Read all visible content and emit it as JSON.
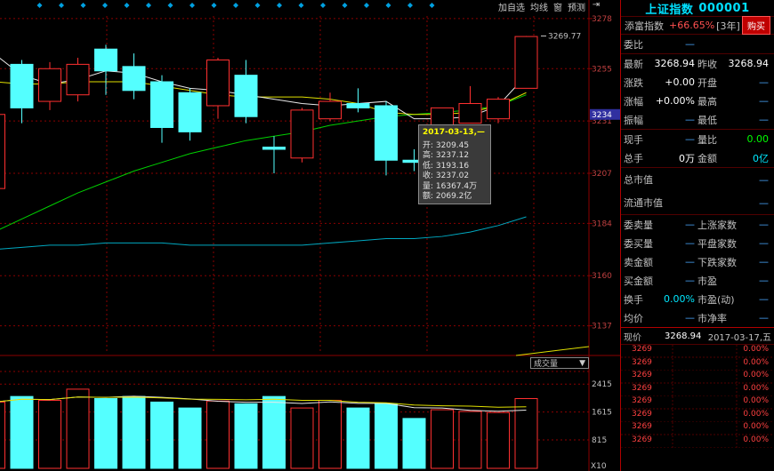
{
  "toolbar": {
    "add_watchlist": "加自选",
    "ma_lines": "均线",
    "window": "窗",
    "forecast": "预测",
    "collapse_icon": "panel-collapse-icon"
  },
  "chart_data": {
    "type": "candlestick",
    "price_axis": {
      "ticks": [
        "3278",
        "3255",
        "3231",
        "3207",
        "3184",
        "3160",
        "3137"
      ],
      "current_label": "3234",
      "ylim": [
        3125,
        3280
      ]
    },
    "volume_axis": {
      "ticks": [
        "2415",
        "1615",
        "815"
      ],
      "unit": "X10"
    },
    "candles": [
      {
        "open": 3200,
        "close": 3234,
        "high": 3238,
        "low": 3193
      },
      {
        "open": 3257,
        "close": 3237,
        "high": 3259,
        "low": 3230
      },
      {
        "open": 3240,
        "close": 3255,
        "high": 3258,
        "low": 3236
      },
      {
        "open": 3243,
        "close": 3257,
        "high": 3260,
        "low": 3240
      },
      {
        "open": 3264,
        "close": 3254,
        "high": 3266,
        "low": 3243
      },
      {
        "open": 3256,
        "close": 3245,
        "high": 3262,
        "low": 3241
      },
      {
        "open": 3249,
        "close": 3228,
        "high": 3252,
        "low": 3221
      },
      {
        "open": 3244,
        "close": 3226,
        "high": 3246,
        "low": 3222
      },
      {
        "open": 3238,
        "close": 3259,
        "high": 3260,
        "low": 3232
      },
      {
        "open": 3252,
        "close": 3233,
        "high": 3259,
        "low": 3230
      },
      {
        "open": 3219,
        "close": 3218,
        "high": 3224,
        "low": 3207
      },
      {
        "open": 3214,
        "close": 3236,
        "high": 3237,
        "low": 3212
      },
      {
        "open": 3232,
        "close": 3240,
        "high": 3244,
        "low": 3231
      },
      {
        "open": 3239,
        "close": 3237,
        "high": 3246,
        "low": 3235
      },
      {
        "open": 3238,
        "close": 3213,
        "high": 3240,
        "low": 3206
      },
      {
        "open": 3213,
        "close": 3212,
        "high": 3218,
        "low": 3208
      },
      {
        "open": 3209.45,
        "close": 3237.02,
        "high": 3237.12,
        "low": 3193.16
      },
      {
        "open": 3230,
        "close": 3239,
        "high": 3247,
        "low": 3231
      },
      {
        "open": 3232,
        "close": 3241,
        "high": 3242,
        "low": 3230
      },
      {
        "open": 3246,
        "close": 3269.77,
        "high": 3270,
        "low": 3246
      }
    ],
    "volumes": [
      1900,
      2060,
      1950,
      2270,
      2000,
      2060,
      1900,
      1730,
      1930,
      1850,
      2060,
      1730,
      1950,
      1730,
      1850,
      1430,
      1680,
      1630,
      1600,
      2000
    ],
    "ma_white": [
      3262,
      3252,
      3248,
      3250,
      3254,
      3253,
      3249,
      3246,
      3245,
      3243,
      3241,
      3239,
      3238,
      3239,
      3240,
      3232,
      3232,
      3233,
      3238,
      3252
    ],
    "ma_yellow": [
      3249,
      3248,
      3248,
      3249,
      3249,
      3249,
      3247,
      3245,
      3243,
      3242,
      3242,
      3242,
      3241,
      3239,
      3235,
      3234,
      3234,
      3235,
      3238,
      3244
    ],
    "ma_green": [
      3180,
      3186,
      3192,
      3198,
      3203,
      3208,
      3212,
      3216,
      3219,
      3222,
      3224,
      3226,
      3229,
      3231,
      3233,
      3234,
      3235,
      3236,
      3238,
      3243
    ],
    "ma_cyan": [
      3172,
      3173,
      3174,
      3174,
      3175,
      3175,
      3175,
      3174,
      3174,
      3174,
      3174,
      3174,
      3175,
      3176,
      3177,
      3177,
      3178,
      3180,
      3183,
      3187
    ],
    "max_label": "3269.77",
    "colors": {
      "up": "#ff3030",
      "down": "#54ffff",
      "ma_white": "#e8e8e8",
      "ma_yellow": "#e0e000",
      "ma_green": "#00d000",
      "ma_cyan": "#00a8c0",
      "grid": "#8b0000"
    }
  },
  "tooltip": {
    "date": "2017-03-13,—",
    "open": "开: 3209.45",
    "high": "高: 3237.12",
    "low": "低: 3193.16",
    "close": "收: 3237.02",
    "volume": "量: 16367.4万",
    "amount": "额: 2069.2亿"
  },
  "volume_selector": {
    "label": "成交量",
    "arrow": "▼"
  },
  "panel": {
    "title": "上证指数",
    "code": "000001",
    "fortune_label": "添富指数",
    "fortune_pct": "+66.65%",
    "fortune_period": "[3年]",
    "buy_label": "购买",
    "rows": [
      {
        "l1": "委比",
        "v1": "—",
        "l2": "",
        "v2": ""
      },
      {
        "l1": "最新",
        "v1": "3268.94",
        "l2": "昨收",
        "v2": "3268.94"
      },
      {
        "l1": "涨跌",
        "v1": "+0.00",
        "l2": "开盘",
        "v2": "—"
      },
      {
        "l1": "涨幅",
        "v1": "+0.00%",
        "l2": "最高",
        "v2": "—"
      },
      {
        "l1": "振幅",
        "v1": "—",
        "l2": "最低",
        "v2": "—"
      },
      {
        "l1": "现手",
        "v1": "—",
        "l2": "量比",
        "v2": "0.00"
      },
      {
        "l1": "总手",
        "v1": "0万",
        "l2": "金额",
        "v2": "0亿"
      }
    ],
    "total_mv_label": "总市值",
    "float_mv_label": "流通市值",
    "bottom_rows": [
      {
        "l1": "委卖量",
        "v1": "—",
        "l2": "上涨家数",
        "v2": "—"
      },
      {
        "l1": "委买量",
        "v1": "—",
        "l2": "平盘家数",
        "v2": "—"
      },
      {
        "l1": "卖金额",
        "v1": "—",
        "l2": "下跌家数",
        "v2": "—"
      },
      {
        "l1": "买金额",
        "v1": "—",
        "l2": "市盈",
        "v2": "—"
      },
      {
        "l1": "换手",
        "v1": "0.00%",
        "l2": "市盈(动)",
        "v2": "—"
      },
      {
        "l1": "均价",
        "v1": "—",
        "l2": "市净率",
        "v2": "—"
      }
    ],
    "tick_header": {
      "label": "现价",
      "price": "3268.94",
      "date": "2017-03-17,五"
    },
    "ticks": [
      {
        "price": "3269",
        "pct": "0.00%"
      },
      {
        "price": "3269",
        "pct": "0.00%"
      },
      {
        "price": "3269",
        "pct": "0.00%"
      },
      {
        "price": "3269",
        "pct": "0.00%"
      },
      {
        "price": "3269",
        "pct": "0.00%"
      },
      {
        "price": "3269",
        "pct": "0.00%"
      },
      {
        "price": "3269",
        "pct": "0.00%"
      },
      {
        "price": "3269",
        "pct": "0.00%"
      }
    ]
  }
}
